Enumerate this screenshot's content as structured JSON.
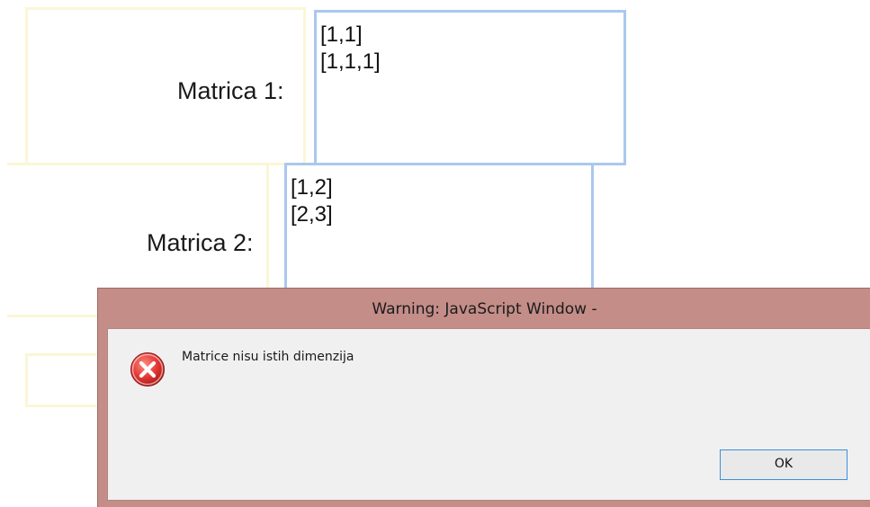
{
  "form": {
    "matrix1": {
      "label": "Matrica 1:",
      "value": "[1,1]\n[1,1,1]"
    },
    "matrix2": {
      "label": "Matrica 2:",
      "value": "[1,2]\n[2,3]"
    }
  },
  "dialog": {
    "title": "Warning: JavaScript Window -",
    "message": "Matrice nisu istih dimenzija",
    "icon": "error-icon",
    "ok_label": "OK"
  },
  "colors": {
    "dialog_frame": "#c48d88",
    "dialog_body": "#f0f0f0",
    "input_border": "#a9c8ee",
    "field_outline": "#fbf6d6",
    "error_red": "#d32f2f",
    "focus_blue": "#3c8fdb"
  }
}
